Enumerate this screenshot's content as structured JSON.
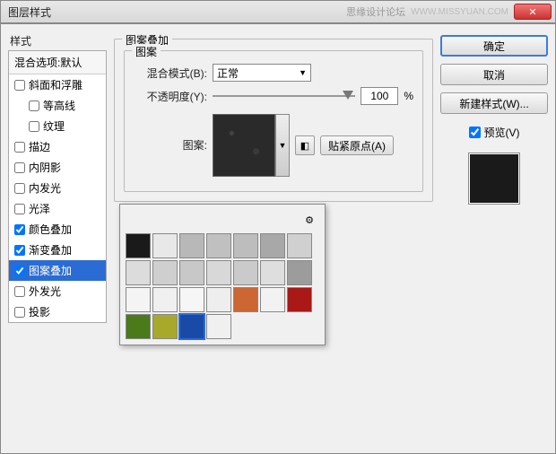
{
  "titlebar": {
    "title": "图层样式",
    "watermark": "思缘设计论坛",
    "watermark2": "WWW.MISSYUAN.COM",
    "close": "✕"
  },
  "left": {
    "label": "样式",
    "header": "混合选项:默认",
    "items": [
      {
        "label": "斜面和浮雕",
        "checked": false
      },
      {
        "label": "等高线",
        "checked": false,
        "sub": true
      },
      {
        "label": "纹理",
        "checked": false,
        "sub": true
      },
      {
        "label": "描边",
        "checked": false
      },
      {
        "label": "内阴影",
        "checked": false
      },
      {
        "label": "内发光",
        "checked": false
      },
      {
        "label": "光泽",
        "checked": false
      },
      {
        "label": "颜色叠加",
        "checked": true
      },
      {
        "label": "渐变叠加",
        "checked": true
      },
      {
        "label": "图案叠加",
        "checked": true,
        "selected": true
      },
      {
        "label": "外发光",
        "checked": false
      },
      {
        "label": "投影",
        "checked": false
      }
    ]
  },
  "center": {
    "group_outer": "图案叠加",
    "group_inner": "图案",
    "blend_label": "混合模式(B):",
    "blend_value": "正常",
    "opacity_label": "不透明度(Y):",
    "opacity_value": "100",
    "opacity_unit": "%",
    "pattern_label": "图案:",
    "snap_btn": "贴紧原点(A)",
    "gear": "⚙",
    "arrow": "▼"
  },
  "swatches": [
    "#1a1a1a",
    "#e8e8e8",
    "#b8b8b8",
    "#c0c0c0",
    "#bdbdbd",
    "#a8a8a8",
    "#d0d0d0",
    "#dcdcdc",
    "#cfcfcf",
    "#c8c8c8",
    "#d8d8d8",
    "#cacaca",
    "#dedede",
    "#9c9c9c",
    "#f4f4f4",
    "#f0f0f0",
    "#f6f6f6",
    "#eeeeee",
    "#cc6633",
    "#f2f2f2",
    "#aa1818",
    "#4a7a1a",
    "#a8a82a",
    "#1a4aa8",
    "#f0f0f0"
  ],
  "swatch_selected": 23,
  "right": {
    "ok": "确定",
    "cancel": "取消",
    "new_style": "新建样式(W)...",
    "preview": "预览(V)",
    "preview_checked": true
  }
}
